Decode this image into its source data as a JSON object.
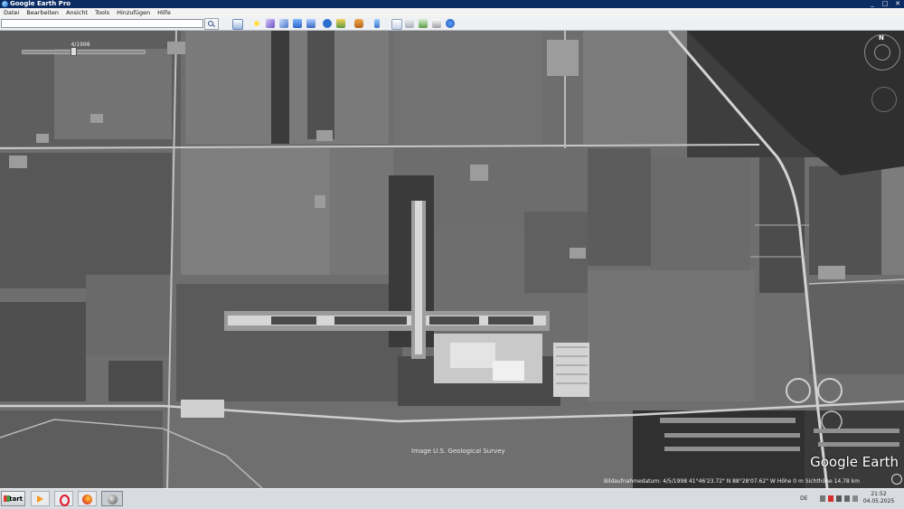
{
  "window": {
    "title": "Google Earth Pro",
    "controls": [
      "_",
      "□",
      "✕"
    ]
  },
  "menu": [
    "Datei",
    "Bearbeiten",
    "Ansicht",
    "Tools",
    "Hinzufügen",
    "Hilfe"
  ],
  "search": {
    "value": "",
    "button_icon": "search-icon"
  },
  "toolbar_icons": [
    "sidebar-toggle-icon",
    "add-placemark-icon",
    "add-polygon-icon",
    "add-path-icon",
    "add-overlay-icon",
    "record-tour-icon",
    "historical-imagery-icon",
    "sunlight-icon",
    "planets-icon",
    "ruler-icon",
    "email-icon",
    "print-icon",
    "save-image-icon",
    "maps-icon"
  ],
  "map": {
    "history_slider": {
      "date": "4/1998"
    },
    "credit": "Image U.S. Geological Survey",
    "logo": "Google Earth",
    "status": "Bildaufnahmedatum: 4/5/1998    41°46'23.72\" N    88°28'07.62\" W  Höhe 0 m    Sichthöhe 14.78 km",
    "compass_label": "N"
  },
  "taskbar": {
    "start_label": "Start",
    "apps": [
      "media-player-icon",
      "opera-icon",
      "firefox-icon",
      "google-earth-icon"
    ],
    "lang": "DE",
    "time": "21:52",
    "date": "04.05.2025"
  },
  "colors": {
    "titlebar": "#0b2c63",
    "taskbar": "#d8dbe0"
  }
}
